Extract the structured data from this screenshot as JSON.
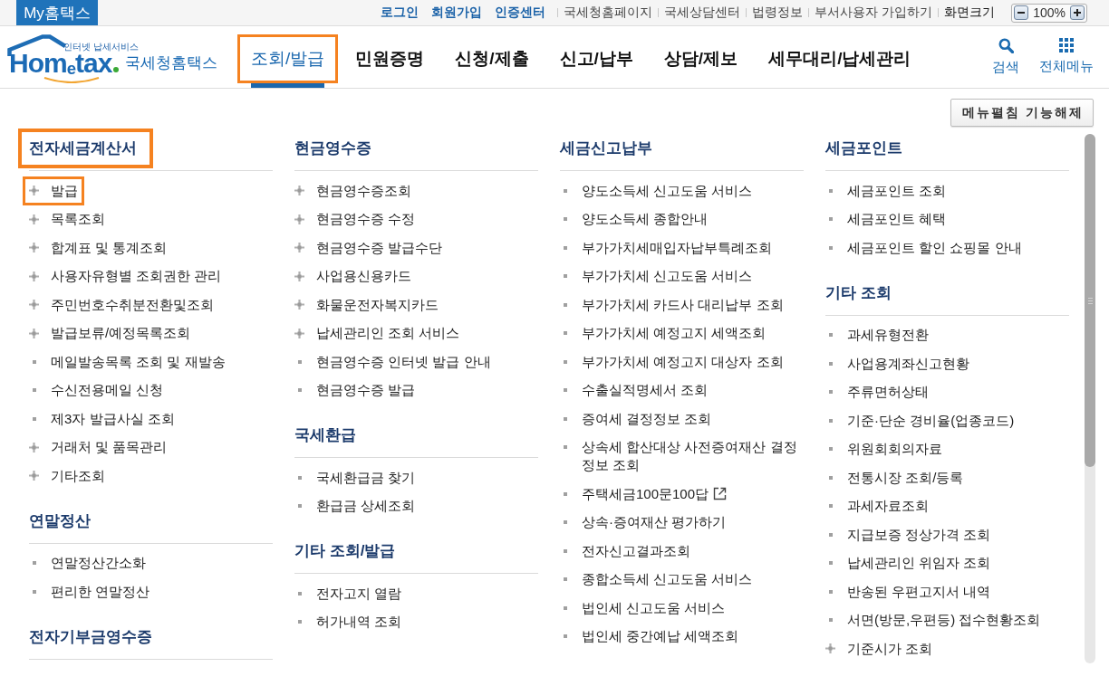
{
  "top_bar": {
    "home_tab": "My홈택스",
    "links": [
      {
        "label": "로그인",
        "kind": "account"
      },
      {
        "label": "회원가입",
        "kind": "account"
      },
      {
        "label": "인증센터",
        "kind": "account"
      },
      {
        "label": "국세청홈페이지",
        "kind": "site"
      },
      {
        "label": "국세상담센터",
        "kind": "site"
      },
      {
        "label": "법령정보",
        "kind": "site"
      },
      {
        "label": "부서사용자 가입하기",
        "kind": "site"
      }
    ],
    "zoom": {
      "label": "화면크기",
      "value": "100%"
    }
  },
  "header": {
    "logo": {
      "tagline": "인터넷 납세서비스",
      "wordmark": "Hom$_{e}$tax",
      "name": "국세청홈택스"
    },
    "nav": [
      {
        "label": "조회/발급",
        "selected": true,
        "highlighted": true
      },
      {
        "label": "민원증명",
        "selected": false,
        "highlighted": false
      },
      {
        "label": "신청/제출",
        "selected": false,
        "highlighted": false
      },
      {
        "label": "신고/납부",
        "selected": false,
        "highlighted": false
      },
      {
        "label": "상담/제보",
        "selected": false,
        "highlighted": false
      },
      {
        "label": "세무대리/납세관리",
        "selected": false,
        "highlighted": false
      }
    ],
    "actions": [
      {
        "label": "검색",
        "kind": "search"
      },
      {
        "label": "전체메뉴",
        "kind": "all-menu"
      }
    ]
  },
  "menu_toggle_button": "메뉴펼침 기능해제",
  "columns": [
    {
      "sections": [
        {
          "title": "전자세금계산서",
          "highlighted": true,
          "items": [
            {
              "label": "발급",
              "expandable": true,
              "highlighted": true
            },
            {
              "label": "목록조회",
              "expandable": true,
              "highlighted": false
            },
            {
              "label": "합계표 및 통계조회",
              "expandable": true,
              "highlighted": false
            },
            {
              "label": "사용자유형별 조회권한 관리",
              "expandable": true,
              "highlighted": false
            },
            {
              "label": "주민번호수취분전환및조회",
              "expandable": true,
              "highlighted": false
            },
            {
              "label": "발급보류/예정목록조회",
              "expandable": true,
              "highlighted": false
            },
            {
              "label": "메일발송목록 조회 및 재발송",
              "expandable": false,
              "highlighted": false
            },
            {
              "label": "수신전용메일 신청",
              "expandable": false,
              "highlighted": false
            },
            {
              "label": "제3자 발급사실 조회",
              "expandable": false,
              "highlighted": false
            },
            {
              "label": "거래처 및 품목관리",
              "expandable": true,
              "highlighted": false
            },
            {
              "label": "기타조회",
              "expandable": true,
              "highlighted": false
            }
          ]
        },
        {
          "title": "연말정산",
          "highlighted": false,
          "items": [
            {
              "label": "연말정산간소화",
              "expandable": false,
              "highlighted": false
            },
            {
              "label": "편리한 연말정산",
              "expandable": false,
              "highlighted": false
            }
          ]
        },
        {
          "title": "전자기부금영수증",
          "highlighted": false
        }
      ]
    },
    {
      "sections": [
        {
          "title": "현금영수증",
          "highlighted": false,
          "items": [
            {
              "label": "현금영수증조회",
              "expandable": true,
              "highlighted": false
            },
            {
              "label": "현금영수증 수정",
              "expandable": true,
              "highlighted": false
            },
            {
              "label": "현금영수증 발급수단",
              "expandable": true,
              "highlighted": false
            },
            {
              "label": "사업용신용카드",
              "expandable": true,
              "highlighted": false
            },
            {
              "label": "화물운전자복지카드",
              "expandable": true,
              "highlighted": false
            },
            {
              "label": "납세관리인 조회 서비스",
              "expandable": true,
              "highlighted": false
            },
            {
              "label": "현금영수증 인터넷 발급 안내",
              "expandable": false,
              "highlighted": false
            },
            {
              "label": "현금영수증 발급",
              "expandable": false,
              "highlighted": false
            }
          ]
        },
        {
          "title": "국세환급",
          "highlighted": false,
          "items": [
            {
              "label": "국세환급금 찾기",
              "expandable": false,
              "highlighted": false
            },
            {
              "label": "환급금 상세조회",
              "expandable": false,
              "highlighted": false
            }
          ]
        },
        {
          "title": "기타 조회/발급",
          "highlighted": false,
          "items": [
            {
              "label": "전자고지 열람",
              "expandable": false,
              "highlighted": false
            },
            {
              "label": "허가내역 조회",
              "expandable": false,
              "highlighted": false
            }
          ]
        }
      ]
    },
    {
      "sections": [
        {
          "title": "세금신고납부",
          "highlighted": false,
          "items": [
            {
              "label": "양도소득세 신고도움 서비스",
              "expandable": false,
              "highlighted": false,
              "external": false
            },
            {
              "label": "양도소득세 종합안내",
              "expandable": false,
              "highlighted": false,
              "external": false
            },
            {
              "label": "부가가치세매입자납부특례조회",
              "expandable": false,
              "highlighted": false,
              "external": false
            },
            {
              "label": "부가가치세 신고도움 서비스",
              "expandable": false,
              "highlighted": false,
              "external": false
            },
            {
              "label": "부가가치세 카드사 대리납부 조회",
              "expandable": false,
              "highlighted": false,
              "external": false
            },
            {
              "label": "부가가치세 예정고지 세액조회",
              "expandable": false,
              "highlighted": false,
              "external": false
            },
            {
              "label": "부가가치세 예정고지 대상자 조회",
              "expandable": false,
              "highlighted": false,
              "external": false
            },
            {
              "label": "수출실적명세서 조회",
              "expandable": false,
              "highlighted": false,
              "external": false
            },
            {
              "label": "증여세 결정정보 조회",
              "expandable": false,
              "highlighted": false,
              "external": false
            },
            {
              "label": "상속세 합산대상 사전증여재산 결정정보 조회",
              "expandable": false,
              "highlighted": false,
              "external": false
            },
            {
              "label": "주택세금100문100답",
              "expandable": false,
              "highlighted": false,
              "external": true
            },
            {
              "label": "상속·증여재산 평가하기",
              "expandable": false,
              "highlighted": false,
              "external": false
            },
            {
              "label": "전자신고결과조회",
              "expandable": false,
              "highlighted": false,
              "external": false
            },
            {
              "label": "종합소득세 신고도움 서비스",
              "expandable": false,
              "highlighted": false,
              "external": false
            },
            {
              "label": "법인세 신고도움 서비스",
              "expandable": false,
              "highlighted": false,
              "external": false
            },
            {
              "label": "법인세 중간예납 세액조회",
              "expandable": false,
              "highlighted": false,
              "external": false
            }
          ]
        }
      ]
    },
    {
      "sections": [
        {
          "title": "세금포인트",
          "highlighted": false,
          "items": [
            {
              "label": "세금포인트 조회",
              "expandable": false,
              "highlighted": false
            },
            {
              "label": "세금포인트 혜택",
              "expandable": false,
              "highlighted": false
            },
            {
              "label": "세금포인트 할인 쇼핑몰 안내",
              "expandable": false,
              "highlighted": false
            }
          ]
        },
        {
          "title": "기타 조회",
          "highlighted": false,
          "items": [
            {
              "label": "과세유형전환",
              "expandable": false,
              "highlighted": false
            },
            {
              "label": "사업용계좌신고현황",
              "expandable": false,
              "highlighted": false
            },
            {
              "label": "주류면허상태",
              "expandable": false,
              "highlighted": false
            },
            {
              "label": "기준·단순 경비율(업종코드)",
              "expandable": false,
              "highlighted": false
            },
            {
              "label": "위원회회의자료",
              "expandable": false,
              "highlighted": false
            },
            {
              "label": "전통시장 조회/등록",
              "expandable": false,
              "highlighted": false
            },
            {
              "label": "과세자료조회",
              "expandable": false,
              "highlighted": false
            },
            {
              "label": "지급보증 정상가격 조회",
              "expandable": false,
              "highlighted": false
            },
            {
              "label": "납세관리인 위임자 조회",
              "expandable": false,
              "highlighted": false
            },
            {
              "label": "반송된 우편고지서 내역",
              "expandable": false,
              "highlighted": false
            },
            {
              "label": "서면(방문,우편등) 접수현황조회",
              "expandable": false,
              "highlighted": false
            },
            {
              "label": "기준시가 조회",
              "expandable": true,
              "highlighted": false
            }
          ]
        }
      ]
    }
  ]
}
